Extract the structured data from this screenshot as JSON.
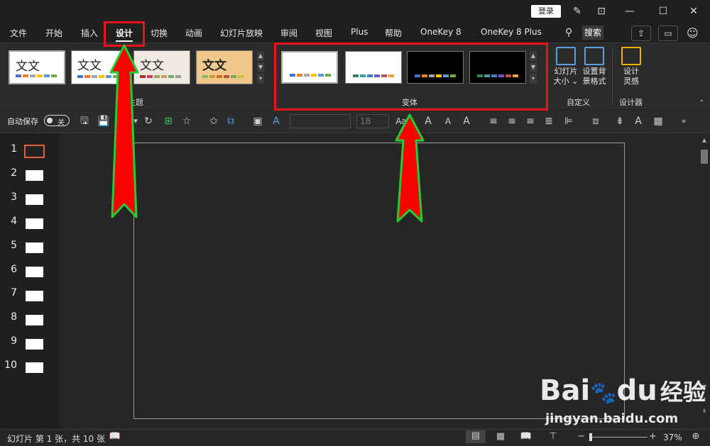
{
  "titlebar": {
    "login_label": "登录"
  },
  "tabs": [
    {
      "label": "文件"
    },
    {
      "label": "开始"
    },
    {
      "label": "插入"
    },
    {
      "label": "设计"
    },
    {
      "label": "切换"
    },
    {
      "label": "动画"
    },
    {
      "label": "幻灯片放映"
    },
    {
      "label": "审阅"
    },
    {
      "label": "视图"
    },
    {
      "label": "Plus"
    },
    {
      "label": "帮助"
    },
    {
      "label": "OneKey 8"
    },
    {
      "label": "OneKey 8 Plus"
    }
  ],
  "search_label": "搜索",
  "ribbon": {
    "themes": {
      "group_label": "主题",
      "thumb_text": "文文"
    },
    "variants": {
      "group_label": "变体"
    },
    "customize": {
      "group_label": "自定义",
      "slide_size_label_1": "幻灯片",
      "slide_size_label_2": "大小",
      "format_bg_label_1": "设置背",
      "format_bg_label_2": "景格式"
    },
    "designer": {
      "group_label": "设计器",
      "label_1": "设计",
      "label_2": "灵感"
    }
  },
  "toolbar": {
    "autosave_label": "自动保存",
    "autosave_state": "关",
    "font_size": "18"
  },
  "slides": {
    "numbers": [
      "1",
      "2",
      "3",
      "4",
      "5",
      "6",
      "7",
      "8",
      "9",
      "10"
    ],
    "selected_index": 1
  },
  "statusbar": {
    "slide_info": "幻灯片 第 1 张，共 10 张",
    "zoom": "37%"
  },
  "watermark": {
    "brand": "Bai",
    "brand2": "du",
    "site_label": "经验",
    "url": "jingyan.baidu.com"
  },
  "colors": {
    "annotation_red": "#e8141c",
    "annotation_green": "#22cc33"
  }
}
